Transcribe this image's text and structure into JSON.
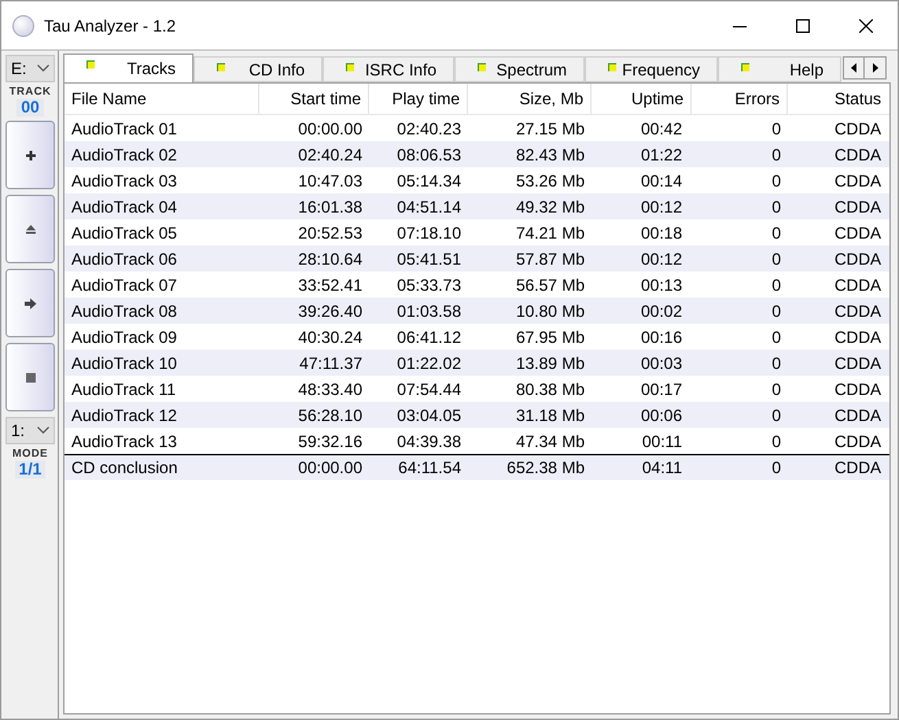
{
  "window": {
    "title": "Tau Analyzer - 1.2"
  },
  "sidebar": {
    "drive": "E:",
    "track_label": "TRACK",
    "track": "00",
    "buttons": [
      {
        "kind": "plus"
      },
      {
        "kind": "eject"
      },
      {
        "kind": "arrow"
      },
      {
        "kind": "stop"
      }
    ],
    "mode_select": "1:",
    "mode_label": "MODE",
    "mode": "1/1"
  },
  "tabs": [
    {
      "label": "Tracks",
      "selected": true
    },
    {
      "label": "CD Info",
      "selected": false
    },
    {
      "label": "ISRC Info",
      "selected": false
    },
    {
      "label": "Spectrum",
      "selected": false
    },
    {
      "label": "Frequency",
      "selected": false
    },
    {
      "label": "Help",
      "selected": false
    }
  ],
  "table": {
    "columns": [
      "File Name",
      "Start time",
      "Play time",
      "Size, Mb",
      "Uptime",
      "Errors",
      "Status"
    ],
    "rows": [
      [
        "AudioTrack 01",
        "00:00.00",
        "02:40.23",
        "27.15 Mb",
        "00:42",
        "0",
        "CDDA"
      ],
      [
        "AudioTrack 02",
        "02:40.24",
        "08:06.53",
        "82.43 Mb",
        "01:22",
        "0",
        "CDDA"
      ],
      [
        "AudioTrack 03",
        "10:47.03",
        "05:14.34",
        "53.26 Mb",
        "00:14",
        "0",
        "CDDA"
      ],
      [
        "AudioTrack 04",
        "16:01.38",
        "04:51.14",
        "49.32 Mb",
        "00:12",
        "0",
        "CDDA"
      ],
      [
        "AudioTrack 05",
        "20:52.53",
        "07:18.10",
        "74.21 Mb",
        "00:18",
        "0",
        "CDDA"
      ],
      [
        "AudioTrack 06",
        "28:10.64",
        "05:41.51",
        "57.87 Mb",
        "00:12",
        "0",
        "CDDA"
      ],
      [
        "AudioTrack 07",
        "33:52.41",
        "05:33.73",
        "56.57 Mb",
        "00:13",
        "0",
        "CDDA"
      ],
      [
        "AudioTrack 08",
        "39:26.40",
        "01:03.58",
        "10.80 Mb",
        "00:02",
        "0",
        "CDDA"
      ],
      [
        "AudioTrack 09",
        "40:30.24",
        "06:41.12",
        "67.95 Mb",
        "00:16",
        "0",
        "CDDA"
      ],
      [
        "AudioTrack 10",
        "47:11.37",
        "01:22.02",
        "13.89 Mb",
        "00:03",
        "0",
        "CDDA"
      ],
      [
        "AudioTrack 11",
        "48:33.40",
        "07:54.44",
        "80.38 Mb",
        "00:17",
        "0",
        "CDDA"
      ],
      [
        "AudioTrack 12",
        "56:28.10",
        "03:04.05",
        "31.18 Mb",
        "00:06",
        "0",
        "CDDA"
      ],
      [
        "AudioTrack 13",
        "59:32.16",
        "04:39.38",
        "47.34 Mb",
        "00:11",
        "0",
        "CDDA"
      ]
    ],
    "total": [
      "CD conclusion",
      "00:00.00",
      "64:11.54",
      "652.38 Mb",
      "04:11",
      "0",
      "CDDA"
    ]
  }
}
